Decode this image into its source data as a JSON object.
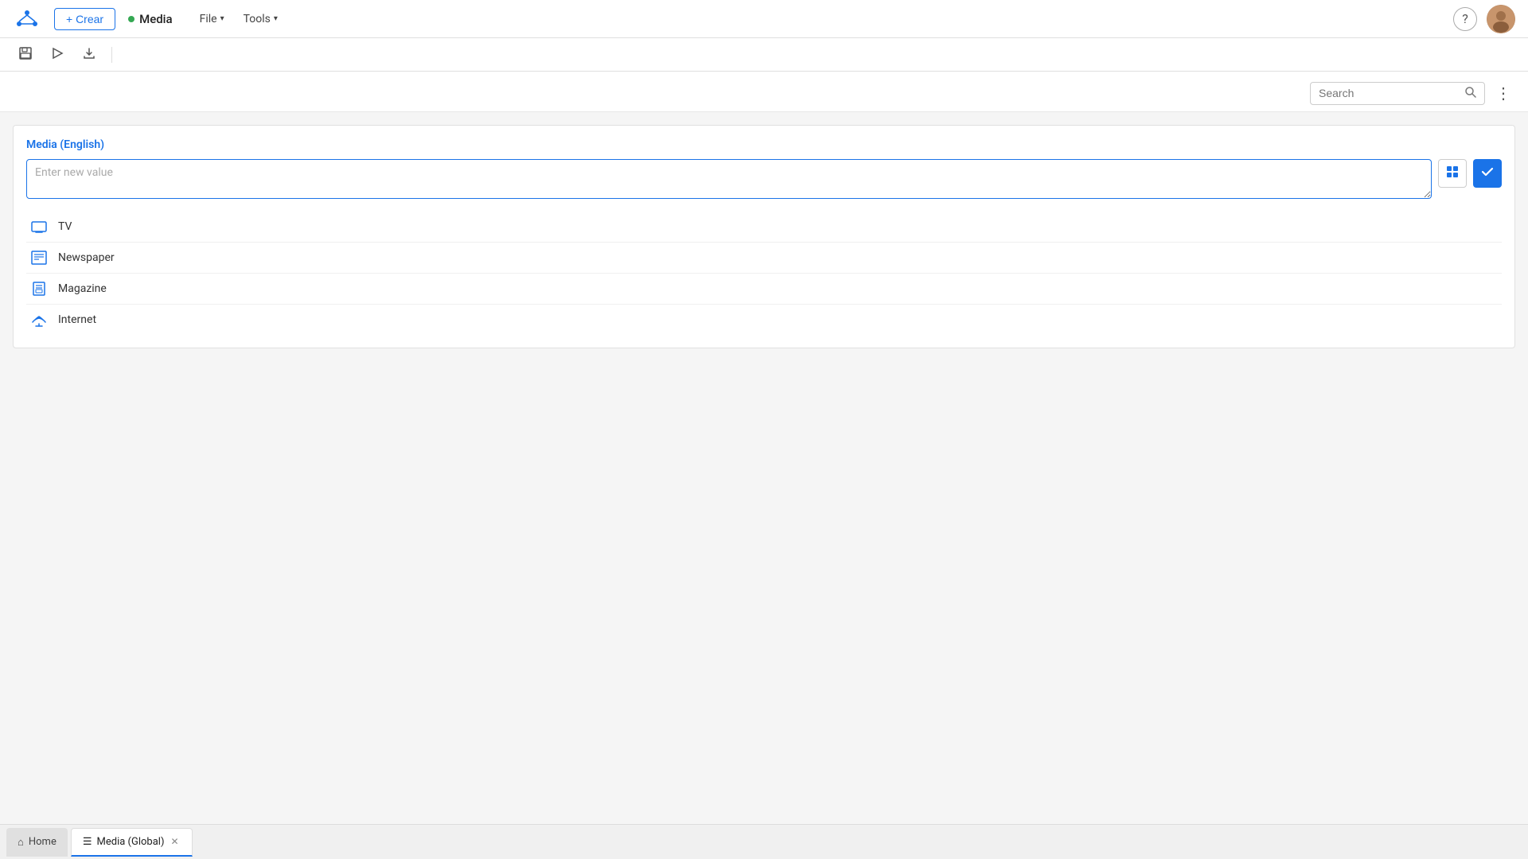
{
  "app": {
    "logo_icon": "network-icon",
    "create_label": "+ Crear",
    "media_label": "Media",
    "nav_items": [
      {
        "label": "File",
        "has_dropdown": true
      },
      {
        "label": "Tools",
        "has_dropdown": true
      }
    ]
  },
  "toolbar": {
    "save_icon": "save-icon",
    "play_icon": "play-icon",
    "export_icon": "export-icon"
  },
  "search": {
    "placeholder": "Search",
    "value": ""
  },
  "main": {
    "section_title": "Media (English)",
    "new_value_placeholder": "Enter new value",
    "list_items": [
      {
        "label": "TV",
        "icon": "tv-icon"
      },
      {
        "label": "Newspaper",
        "icon": "newspaper-icon"
      },
      {
        "label": "Magazine",
        "icon": "magazine-icon"
      },
      {
        "label": "Internet",
        "icon": "internet-icon"
      }
    ]
  },
  "tabs": {
    "home_label": "Home",
    "media_global_label": "Media (Global)"
  }
}
